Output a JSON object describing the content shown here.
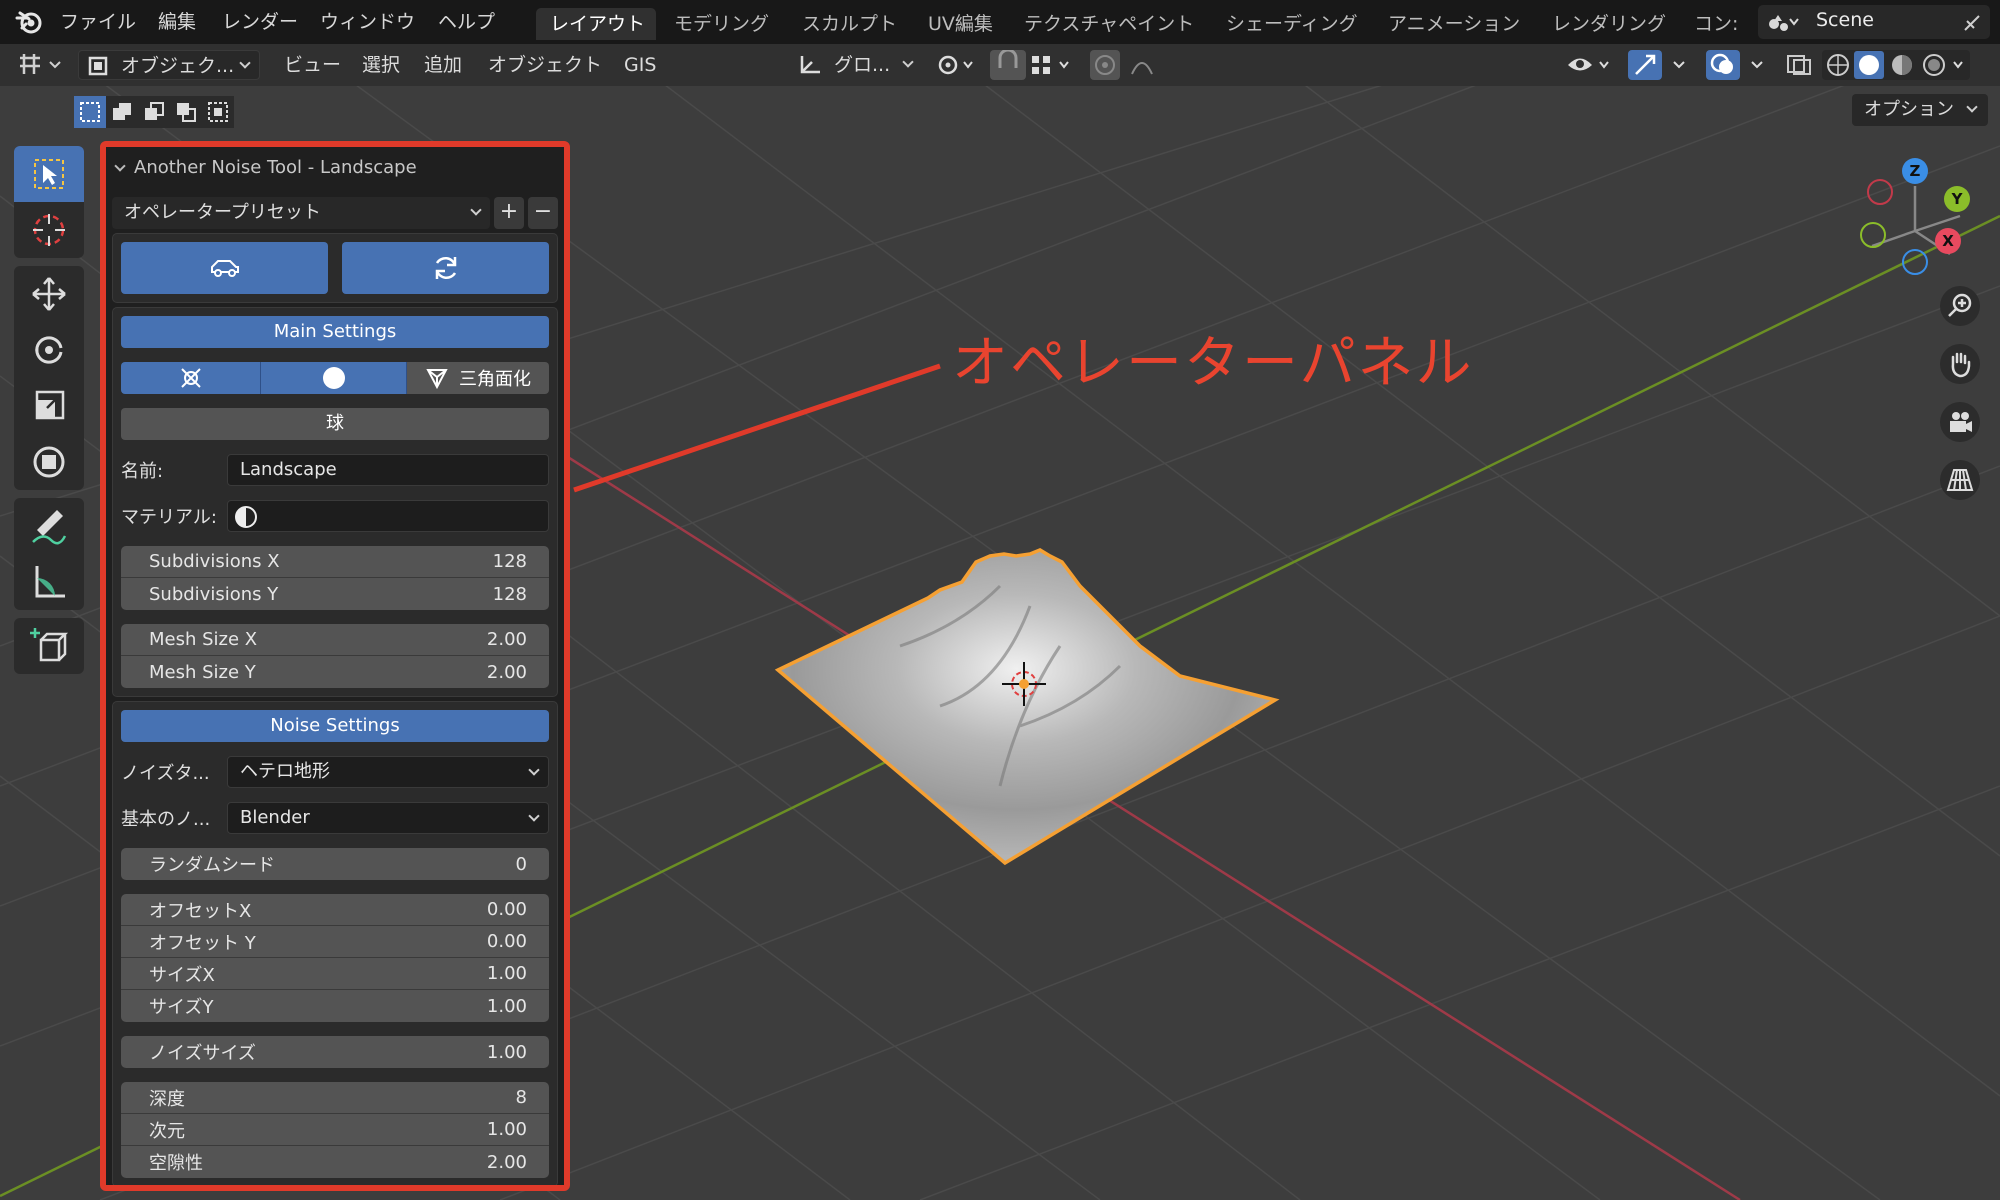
{
  "menu": {
    "items": [
      "ファイル",
      "編集",
      "レンダー",
      "ウィンドウ",
      "ヘルプ"
    ]
  },
  "workspace_tabs": [
    "レイアウト",
    "モデリング",
    "スカルプト",
    "UV編集",
    "テクスチャペイント",
    "シェーディング",
    "アニメーション",
    "レンダリング",
    "コン:"
  ],
  "active_workspace": "レイアウト",
  "scene_name": "Scene",
  "header": {
    "mode_label": "オブジェク...",
    "view": "ビュー",
    "select": "選択",
    "add": "追加",
    "object": "オブジェクト",
    "gis": "GIS",
    "transform_orientation": "グロ...",
    "options_label": "オプション"
  },
  "operator_panel": {
    "title": "Another Noise Tool - Landscape",
    "preset": "オペレータープリセット",
    "main_settings": "Main Settings",
    "triangulate": "三角面化",
    "sphere": "球",
    "name_label": "名前:",
    "name_value": "Landscape",
    "material_label": "マテリアル:",
    "subdivisions": [
      {
        "label": "Subdivisions X",
        "value": "128"
      },
      {
        "label": "Subdivisions Y",
        "value": "128"
      }
    ],
    "mesh_size": [
      {
        "label": "Mesh Size X",
        "value": "2.00"
      },
      {
        "label": "Mesh Size Y",
        "value": "2.00"
      }
    ],
    "noise_settings": "Noise Settings",
    "noise_type_label": "ノイズタ...",
    "noise_type_value": "ヘテロ地形",
    "basis_label": "基本のノ...",
    "basis_value": "Blender",
    "random_seed": {
      "label": "ランダムシード",
      "value": "0"
    },
    "offsets": [
      {
        "label": "オフセットX",
        "value": "0.00"
      },
      {
        "label": "オフセット Y",
        "value": "0.00"
      },
      {
        "label": "サイズX",
        "value": "1.00"
      },
      {
        "label": "サイズY",
        "value": "1.00"
      }
    ],
    "noise_size": {
      "label": "ノイズサイズ",
      "value": "1.00"
    },
    "detail": [
      {
        "label": "深度",
        "value": "8"
      },
      {
        "label": "次元",
        "value": "1.00"
      },
      {
        "label": "空隙性",
        "value": "2.00"
      }
    ]
  },
  "annotation": "オペレーターパネル",
  "gizmo": {
    "x": "X",
    "y": "Y",
    "z": "Z"
  },
  "colors": {
    "accent": "#4772b3",
    "highlight": "#e03a2a",
    "selection_outline": "#f5a033",
    "axis_x": "#e84a5f",
    "axis_y": "#8bbd2a",
    "axis_z": "#3a8ee6"
  }
}
